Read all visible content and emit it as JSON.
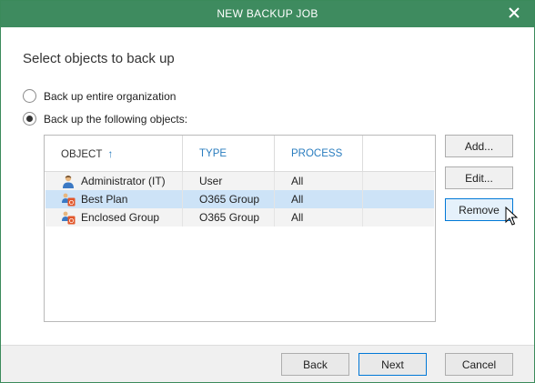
{
  "window": {
    "title": "NEW BACKUP JOB",
    "close_icon": "close-icon"
  },
  "heading": "Select objects to back up",
  "options": [
    {
      "label": "Back up entire organization",
      "checked": false
    },
    {
      "label": "Back up the following objects:",
      "checked": true
    }
  ],
  "grid": {
    "columns": [
      "OBJECT",
      "TYPE",
      "PROCESS"
    ],
    "sort_icon": "arrow-up-icon",
    "rows": [
      {
        "object": "Administrator (IT)",
        "type": "User",
        "process": "All",
        "icon": "user-icon",
        "selected": false
      },
      {
        "object": "Best Plan",
        "type": "O365 Group",
        "process": "All",
        "icon": "group-icon",
        "selected": true
      },
      {
        "object": "Enclosed Group",
        "type": "O365 Group",
        "process": "All",
        "icon": "group-icon",
        "selected": false
      }
    ]
  },
  "side_buttons": {
    "add": "Add...",
    "edit": "Edit...",
    "remove": "Remove"
  },
  "footer": {
    "back": "Back",
    "next": "Next",
    "cancel": "Cancel"
  },
  "colors": {
    "titlebar": "#3e8b5f",
    "accent": "#2a7dbf",
    "selection": "#cde3f7"
  }
}
